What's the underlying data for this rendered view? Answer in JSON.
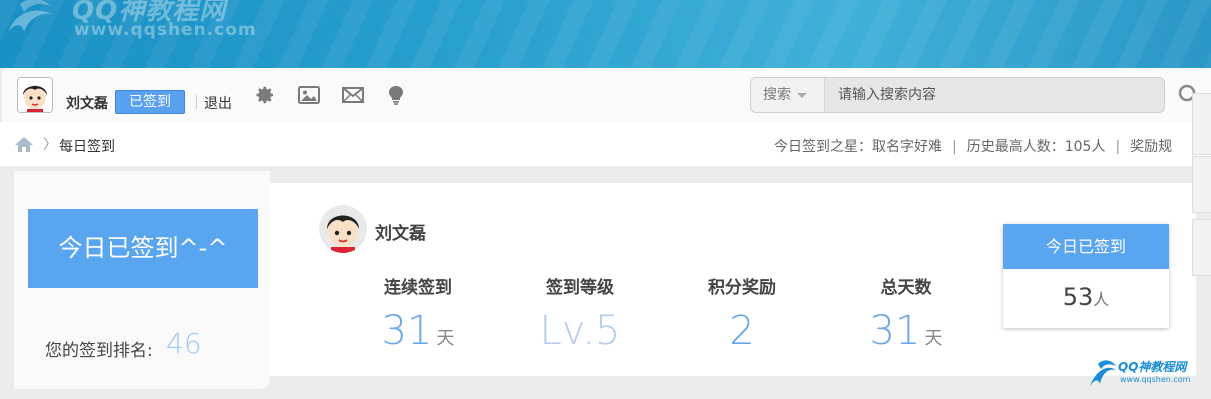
{
  "banner": {
    "site_title": "QQ神教程网",
    "site_url": "www.qqshen.com"
  },
  "toolbar": {
    "username": "刘文磊",
    "checked_badge": "已签到",
    "logout": "退出",
    "icons": [
      "gear-icon",
      "image-icon",
      "mail-icon",
      "lightbulb-icon"
    ],
    "search": {
      "type_label": "搜索",
      "placeholder": "请输入搜索内容"
    }
  },
  "breadcrumb": {
    "current": "每日签到"
  },
  "stats_line": {
    "star_label": "今日签到之星：",
    "star_name": "取名字好难",
    "record_label": "历史最高人数：",
    "record_value": "105人",
    "reward_label": "奖励规"
  },
  "left_panel": {
    "button_label": "今日已签到^-^",
    "rank_label": "您的签到排名:",
    "rank_value": "46"
  },
  "card": {
    "username": "刘文磊",
    "stats": [
      {
        "label": "连续签到",
        "value": "31",
        "unit": "天"
      },
      {
        "label": "签到等级",
        "value": "Lv.5",
        "unit": ""
      },
      {
        "label": "积分奖励",
        "value": "2",
        "unit": ""
      },
      {
        "label": "总天数",
        "value": "31",
        "unit": "天"
      }
    ],
    "today": {
      "title": "今日已签到",
      "count": "53",
      "unit": "人"
    }
  },
  "footer_logo": {
    "title": "QQ神教程网",
    "url": "www.qqshen.com"
  },
  "colors": {
    "accent": "#5aa5f0",
    "banner": "#2aa0cf",
    "number": "#6aa8ec"
  }
}
